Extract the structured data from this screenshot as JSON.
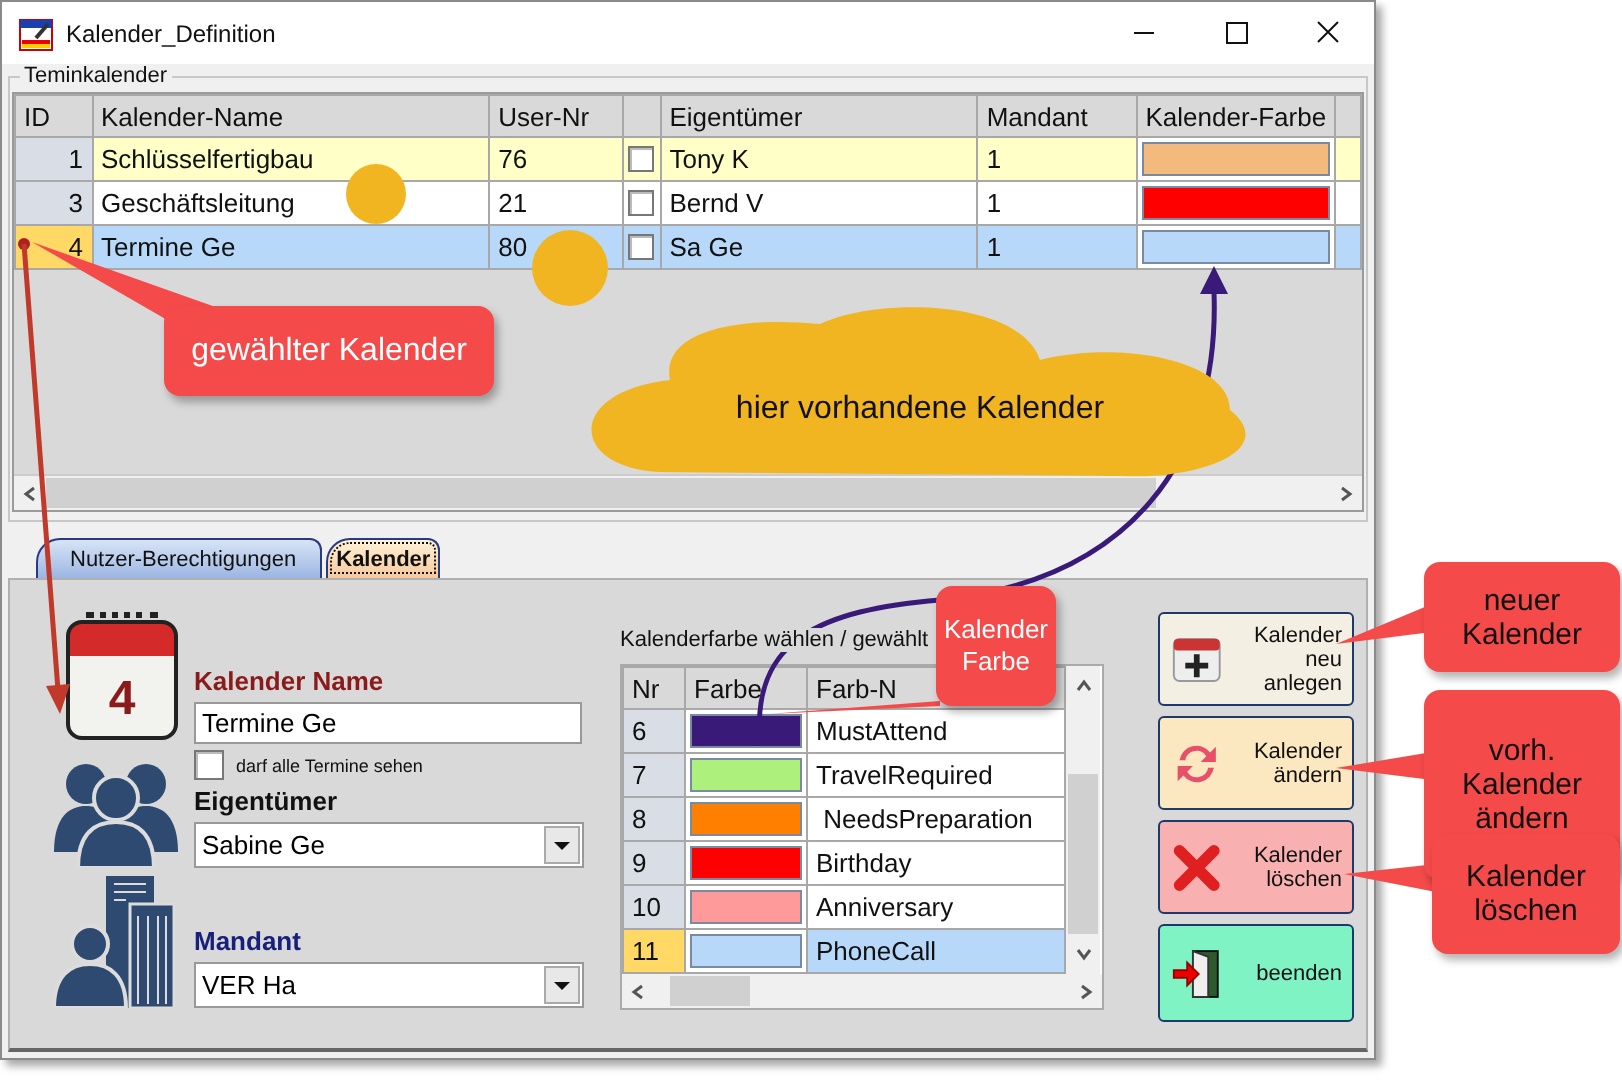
{
  "window": {
    "title": "Kalender_Definition"
  },
  "calendars": {
    "title": "Teminkalender",
    "columns": [
      "ID",
      "Kalender-Name",
      "User-Nr",
      "Eigentümer",
      "Mandant",
      "Kalender-Farbe"
    ],
    "rows": [
      {
        "id": "1",
        "name": "Schlüsselfertigbau",
        "user_nr": "76",
        "checked": false,
        "owner": "Tony K",
        "mandant": "1",
        "color": "#f4b97c",
        "selected": false
      },
      {
        "id": "3",
        "name": "Geschäftsleitung",
        "user_nr": "21",
        "checked": false,
        "owner": "Bernd V",
        "mandant": "1",
        "color": "#ff0000",
        "selected": false
      },
      {
        "id": "4",
        "name": "Termine Ge",
        "user_nr": "80",
        "checked": false,
        "owner": "Sa    Ge",
        "mandant": "1",
        "color": "#b8d8fa",
        "selected": true
      }
    ]
  },
  "tabs": [
    {
      "label": "Nutzer-Berechtigungen",
      "selected": false
    },
    {
      "label": "Kalender",
      "selected": true
    }
  ],
  "form": {
    "calendar_day": "4",
    "name_label": "Kalender Name",
    "name_value": "Termine Ge",
    "see_all": {
      "label": "darf alle Termine sehen",
      "checked": false
    },
    "owner_label": "Eigentümer",
    "owner_value": "Sabine Ge",
    "mandant_label": "Mandant",
    "mandant_value": "VER    Ha"
  },
  "color_table": {
    "caption": "Kalenderfarbe wählen / gewählt",
    "columns": [
      "Nr",
      "Farbe",
      "Farb-N"
    ],
    "rows": [
      {
        "nr": "6",
        "color": "#3a1a78",
        "name": "MustAttend",
        "selected": false
      },
      {
        "nr": "7",
        "color": "#adf07c",
        "name": "TravelRequired",
        "selected": false
      },
      {
        "nr": "8",
        "color": "#ff7f00",
        "name": " NeedsPreparation",
        "selected": false
      },
      {
        "nr": "9",
        "color": "#ff0000",
        "name": "Birthday",
        "selected": false
      },
      {
        "nr": "10",
        "color": "#ff9a9a",
        "name": "Anniversary",
        "selected": false
      },
      {
        "nr": "11",
        "color": "#b8d8fa",
        "name": "PhoneCall",
        "selected": true
      }
    ]
  },
  "buttons": [
    {
      "kind": "new",
      "label": "Kalender neu anlegen"
    },
    {
      "kind": "edit",
      "label": "Kalender ändern"
    },
    {
      "kind": "delete",
      "label": "Kalender löschen"
    },
    {
      "kind": "exit",
      "label": "beenden"
    }
  ],
  "annotations": [
    {
      "kind": "box",
      "text": "gewählter Kalender"
    },
    {
      "kind": "cloud",
      "text": "hier vorhandene Kalender"
    },
    {
      "kind": "box",
      "text": "Kalender Farbe"
    },
    {
      "kind": "tag",
      "text": "neuer Kalender"
    },
    {
      "kind": "tag",
      "text": "vorh. Kalender ändern"
    },
    {
      "kind": "tag",
      "text": "Kalender löschen"
    }
  ]
}
